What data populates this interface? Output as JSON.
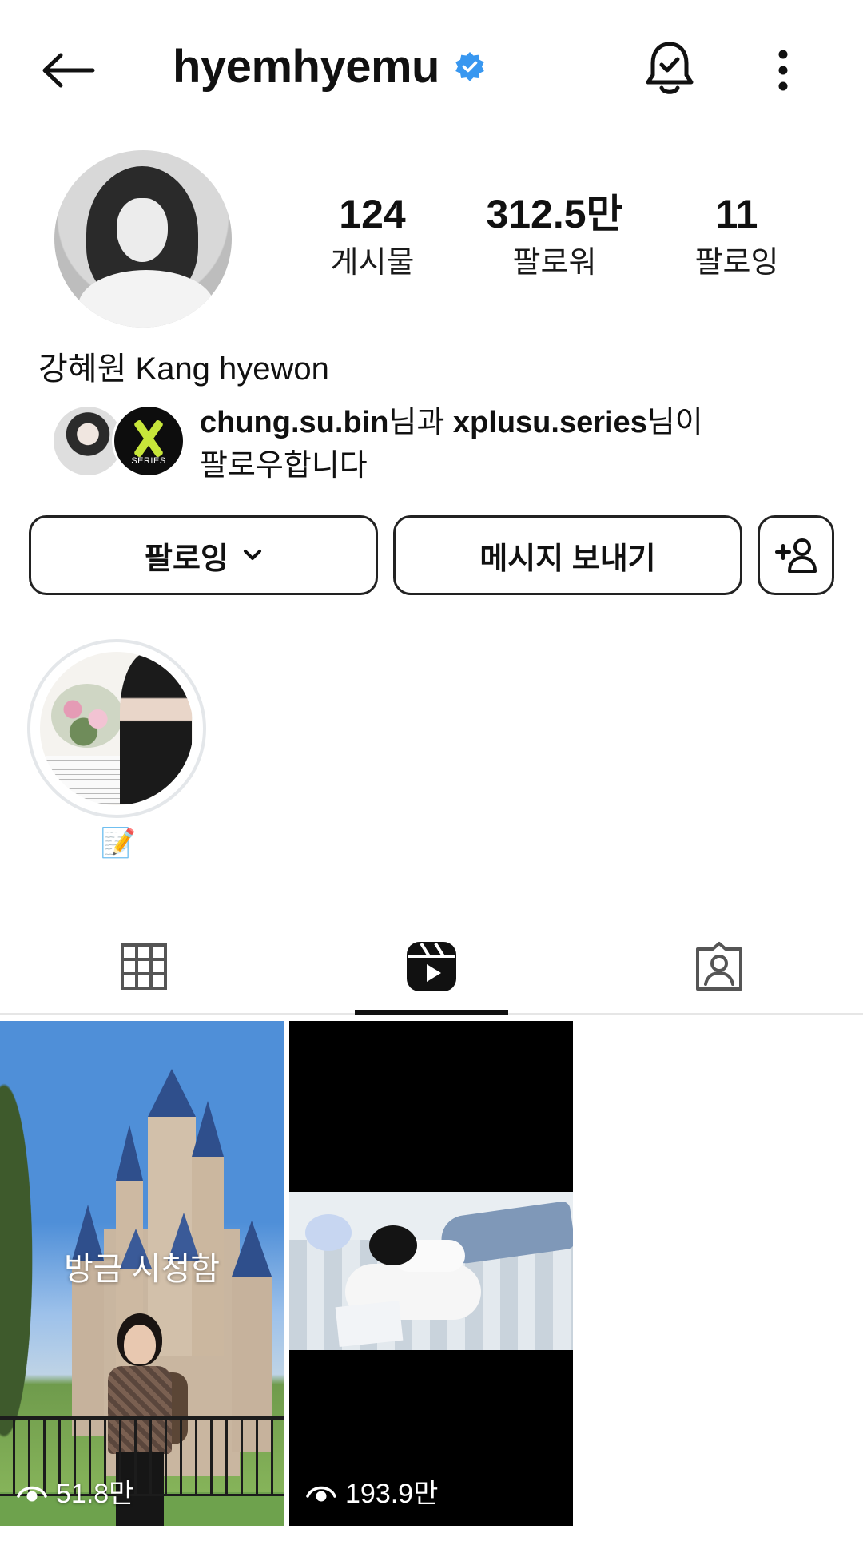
{
  "header": {
    "username": "hyemhyemu",
    "verified": true,
    "icons": [
      "back-arrow-icon",
      "verified-badge-icon",
      "notification-bell-icon",
      "more-options-icon"
    ]
  },
  "profile": {
    "full_name": "강혜원 Kang hyewon",
    "stats": [
      {
        "value": "124",
        "label": "게시물"
      },
      {
        "value": "312.5만",
        "label": "팔로워"
      },
      {
        "value": "11",
        "label": "팔로잉"
      }
    ],
    "mutual": {
      "user1": "chung.su.bin",
      "connector": "님과 ",
      "user2": "xplusu.series",
      "suffix": "님이",
      "line2": "팔로우합니다",
      "avatar2_text": "SERIES"
    }
  },
  "actions": {
    "following_label": "팔로잉",
    "message_label": "메시지 보내기"
  },
  "highlights": [
    {
      "label": "📝"
    }
  ],
  "tabs": {
    "active": "reels",
    "items": [
      "grid-icon",
      "reels-icon",
      "tagged-icon"
    ]
  },
  "reels": [
    {
      "overlay": "방금 시청함",
      "views": "51.8만"
    },
    {
      "overlay": "",
      "views": "193.9만"
    }
  ],
  "colors": {
    "verified_blue": "#3897f0",
    "text": "#111111",
    "border": "#222222",
    "divider": "#e6e6e6",
    "highlight_ring": "#e4e7ea"
  }
}
